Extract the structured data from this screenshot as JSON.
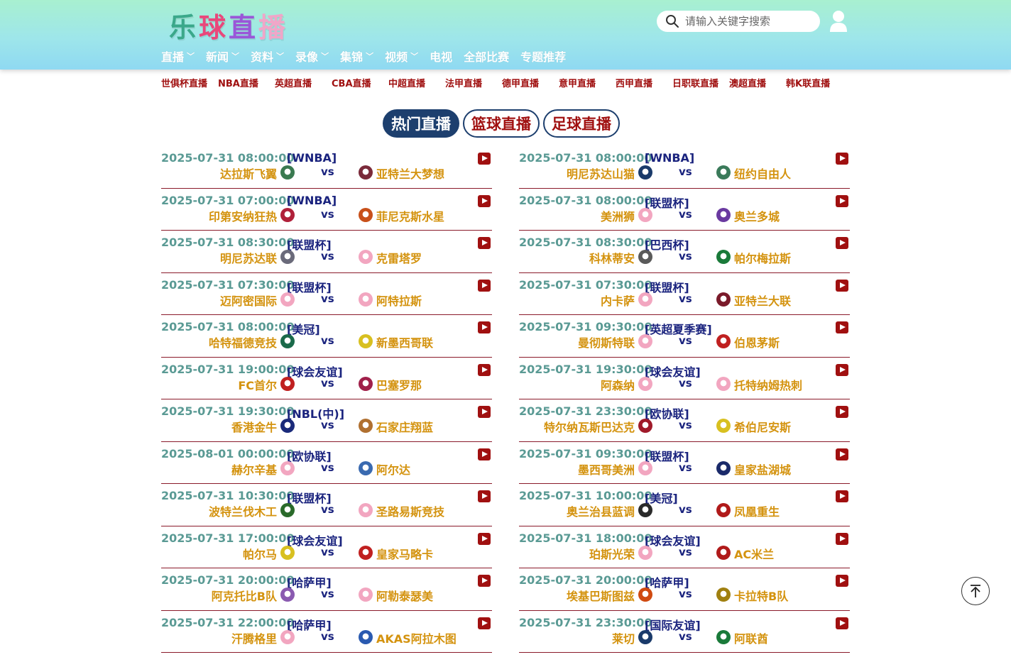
{
  "logo": {
    "chars": [
      "乐",
      "球",
      "直",
      "播"
    ]
  },
  "search": {
    "placeholder": "请输入关键字搜索"
  },
  "icons": {
    "search": "search-icon",
    "user": "user-icon",
    "top": "arrow-up-icon"
  },
  "nav": {
    "items": [
      {
        "label": "直播",
        "dropdown": true
      },
      {
        "label": "新闻",
        "dropdown": true
      },
      {
        "label": "资料",
        "dropdown": true
      },
      {
        "label": "录像",
        "dropdown": true
      },
      {
        "label": "集锦",
        "dropdown": true
      },
      {
        "label": "视频",
        "dropdown": true
      },
      {
        "label": "电视",
        "dropdown": false
      },
      {
        "label": "全部比赛",
        "dropdown": false
      },
      {
        "label": "专题推荐",
        "dropdown": false
      }
    ]
  },
  "sub_links": [
    "世俱杯直播",
    "NBA直播",
    "英超直播",
    "CBA直播",
    "中超直播",
    "法甲直播",
    "德甲直播",
    "意甲直播",
    "西甲直播",
    "日职联直播",
    "澳超直播",
    "韩K联直播"
  ],
  "tabs": [
    {
      "label": "热门直播",
      "active": true
    },
    {
      "label": "篮球直播",
      "active": false
    },
    {
      "label": "足球直播",
      "active": false
    }
  ],
  "vs_label": "vs",
  "columns": {
    "left": [
      {
        "time": "2025-07-31 08:00:00",
        "league": "[WNBA]",
        "home": "达拉斯飞翼",
        "away": "亚特兰大梦想",
        "hc": "#3a7a50",
        "ac": "#7a2a3a"
      },
      {
        "time": "2025-07-31 07:00:00",
        "league": "[WNBA]",
        "home": "印第安纳狂热",
        "away": "菲尼克斯水星",
        "hc": "#b0203a",
        "ac": "#c8501a"
      },
      {
        "time": "2025-07-31 08:30:00",
        "league": "[联盟杯]",
        "home": "明尼苏达联",
        "away": "克雷塔罗",
        "hc": "#6a6a7a",
        "ac": "#f2a6c0"
      },
      {
        "time": "2025-07-31 07:30:00",
        "league": "[联盟杯]",
        "home": "迈阿密国际",
        "away": "阿特拉斯",
        "hc": "#f2a6c0",
        "ac": "#f2a6c0"
      },
      {
        "time": "2025-07-31 08:00:00",
        "league": "[美冠]",
        "home": "哈特福德竞技",
        "away": "新墨西哥联",
        "hc": "#1a6a4a",
        "ac": "#d8c020"
      },
      {
        "time": "2025-07-31 19:00:00",
        "league": "[球会友谊]",
        "home": "FC首尔",
        "away": "巴塞罗那",
        "hc": "#c02020",
        "ac": "#a0204a"
      },
      {
        "time": "2025-07-31 19:30:00",
        "league": "[NBL(中)]",
        "home": "香港金牛",
        "away": "石家庄翔蓝",
        "hc": "#1a2a7a",
        "ac": "#b07030"
      },
      {
        "time": "2025-08-01 00:00:00",
        "league": "[欧协联]",
        "home": "赫尔辛基",
        "away": "阿尔达",
        "hc": "#f2a6c0",
        "ac": "#3a6ab0"
      },
      {
        "time": "2025-07-31 10:30:00",
        "league": "[联盟杯]",
        "home": "波特兰伐木工",
        "away": "圣路易斯竞技",
        "hc": "#2a6a2a",
        "ac": "#f2a6c0"
      },
      {
        "time": "2025-07-31 17:00:00",
        "league": "[球会友谊]",
        "home": "帕尔马",
        "away": "皇家马略卡",
        "hc": "#d8c020",
        "ac": "#c02020"
      },
      {
        "time": "2025-07-31 20:00:00",
        "league": "[哈萨甲]",
        "home": "阿克托比B队",
        "away": "阿勒泰瑟美",
        "hc": "#8a5ab0",
        "ac": "#f2a6c0"
      },
      {
        "time": "2025-07-31 22:00:00",
        "league": "[哈萨甲]",
        "home": "汗腾格里",
        "away": "AKAS阿拉木图",
        "hc": "#f2a6c0",
        "ac": "#2a5ab0"
      }
    ],
    "right": [
      {
        "time": "2025-07-31 08:00:00",
        "league": "[WNBA]",
        "home": "明尼苏达山猫",
        "away": "纽约自由人",
        "hc": "#1a3a6a",
        "ac": "#3a7a5a"
      },
      {
        "time": "2025-07-31 08:00:00",
        "league": "[联盟杯]",
        "home": "美洲狮",
        "away": "奥兰多城",
        "hc": "#f2a6c0",
        "ac": "#6a3aa0"
      },
      {
        "time": "2025-07-31 08:30:00",
        "league": "[巴西杯]",
        "home": "科林蒂安",
        "away": "帕尔梅拉斯",
        "hc": "#5a5a5a",
        "ac": "#1a7a3a"
      },
      {
        "time": "2025-07-31 07:30:00",
        "league": "[联盟杯]",
        "home": "内卡萨",
        "away": "亚特兰大联",
        "hc": "#f2a6c0",
        "ac": "#7a1a2a"
      },
      {
        "time": "2025-07-31 09:30:00",
        "league": "[英超夏季赛]",
        "home": "曼彻斯特联",
        "away": "伯恩茅斯",
        "hc": "#f2a6c0",
        "ac": "#c02020"
      },
      {
        "time": "2025-07-31 19:30:00",
        "league": "[球会友谊]",
        "home": "阿森纳",
        "away": "托特纳姆热刺",
        "hc": "#f2a6c0",
        "ac": "#f2a6c0"
      },
      {
        "time": "2025-07-31 23:30:00",
        "league": "[欧协联]",
        "home": "特尔纳瓦斯巴达克",
        "away": "希伯尼安斯",
        "hc": "#a01a2a",
        "ac": "#d8c020"
      },
      {
        "time": "2025-07-31 09:30:00",
        "league": "[联盟杯]",
        "home": "墨西哥美洲",
        "away": "皇家盐湖城",
        "hc": "#f2a6c0",
        "ac": "#1a2a6a"
      },
      {
        "time": "2025-07-31 10:00:00",
        "league": "[美冠]",
        "home": "奥兰治县蓝调",
        "away": "凤凰重生",
        "hc": "#2a2a2a",
        "ac": "#b01a1a"
      },
      {
        "time": "2025-07-31 18:00:00",
        "league": "[球会友谊]",
        "home": "珀斯光荣",
        "away": "AC米兰",
        "hc": "#f2a6c0",
        "ac": "#b01a1a"
      },
      {
        "time": "2025-07-31 20:00:00",
        "league": "[哈萨甲]",
        "home": "埃基巴斯图兹",
        "away": "卡拉特B队",
        "hc": "#d04a10",
        "ac": "#a08010"
      },
      {
        "time": "2025-07-31 23:30:00",
        "league": "[国际友谊]",
        "home": "莱切",
        "away": "阿联酋",
        "hc": "#1a3a6a",
        "ac": "#1a7a3a"
      }
    ]
  }
}
